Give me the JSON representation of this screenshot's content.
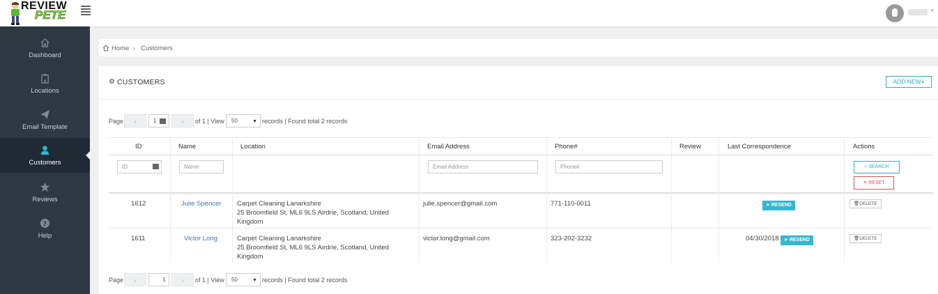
{
  "app": {
    "logo_line1": "REVIEW",
    "logo_line2": "PETE"
  },
  "header": {
    "user_name": "Hidden"
  },
  "sidebar": {
    "items": [
      {
        "label": "Dashboard",
        "icon": "home-icon"
      },
      {
        "label": "Locations",
        "icon": "building-icon"
      },
      {
        "label": "Email Template",
        "icon": "paper-plane-icon"
      },
      {
        "label": "Customers",
        "icon": "user-icon",
        "active": true
      },
      {
        "label": "Reviews",
        "icon": "star-icon"
      },
      {
        "label": "Help",
        "icon": "question-icon"
      }
    ]
  },
  "breadcrumb": {
    "home": "Home",
    "sep": "›",
    "current": "Customers"
  },
  "panel": {
    "title": "CUSTOMERS",
    "add_new": "ADD NEW"
  },
  "pager": {
    "page_label": "Page",
    "prev": "‹",
    "next": "›",
    "current_page": "1",
    "of_text": "of 1 | View",
    "per_page": "50",
    "records_text": "records | Found total 2 records"
  },
  "table": {
    "columns": [
      "ID",
      "Name",
      "Location",
      "Email Address",
      "Phone#",
      "Review",
      "Last Correspondence",
      "Actions"
    ],
    "filters": {
      "id_placeholder": "ID",
      "name_placeholder": "Name",
      "email_placeholder": "Email Address",
      "phone_placeholder": "Phone#",
      "search": "SEARCH",
      "reset": "RESET"
    },
    "rows": [
      {
        "id": "1612",
        "name": "Julie Spencer",
        "location_line1": "Carpet Cleaning Lanarkshire",
        "location_line2": "25 Broomfield St, ML6 9LS Airdrie, Scotland, United",
        "location_line3": "Kingdom",
        "email": "julie.spencer@gmail.com",
        "phone": "771-110-0011",
        "review": "",
        "last_correspondence": "",
        "resend": "RESEND",
        "delete": "DELETE"
      },
      {
        "id": "1611",
        "name": "Victor Long",
        "location_line1": "Carpet Cleaning Lanarkshire",
        "location_line2": "25 Broomfield St, ML6 9LS Airdrie, Scotland, United",
        "location_line3": "Kingdom",
        "email": "victor.long@gmail.com",
        "phone": "323-202-3232",
        "review": "",
        "last_correspondence": "04/30/2018",
        "resend": "RESEND",
        "delete": "DELETE"
      }
    ]
  },
  "colors": {
    "sidebar_bg": "#2d3843",
    "accent": "#36b7d0",
    "link": "#3b78b4",
    "danger": "#d9534f",
    "logo_green": "#8ed43a"
  }
}
